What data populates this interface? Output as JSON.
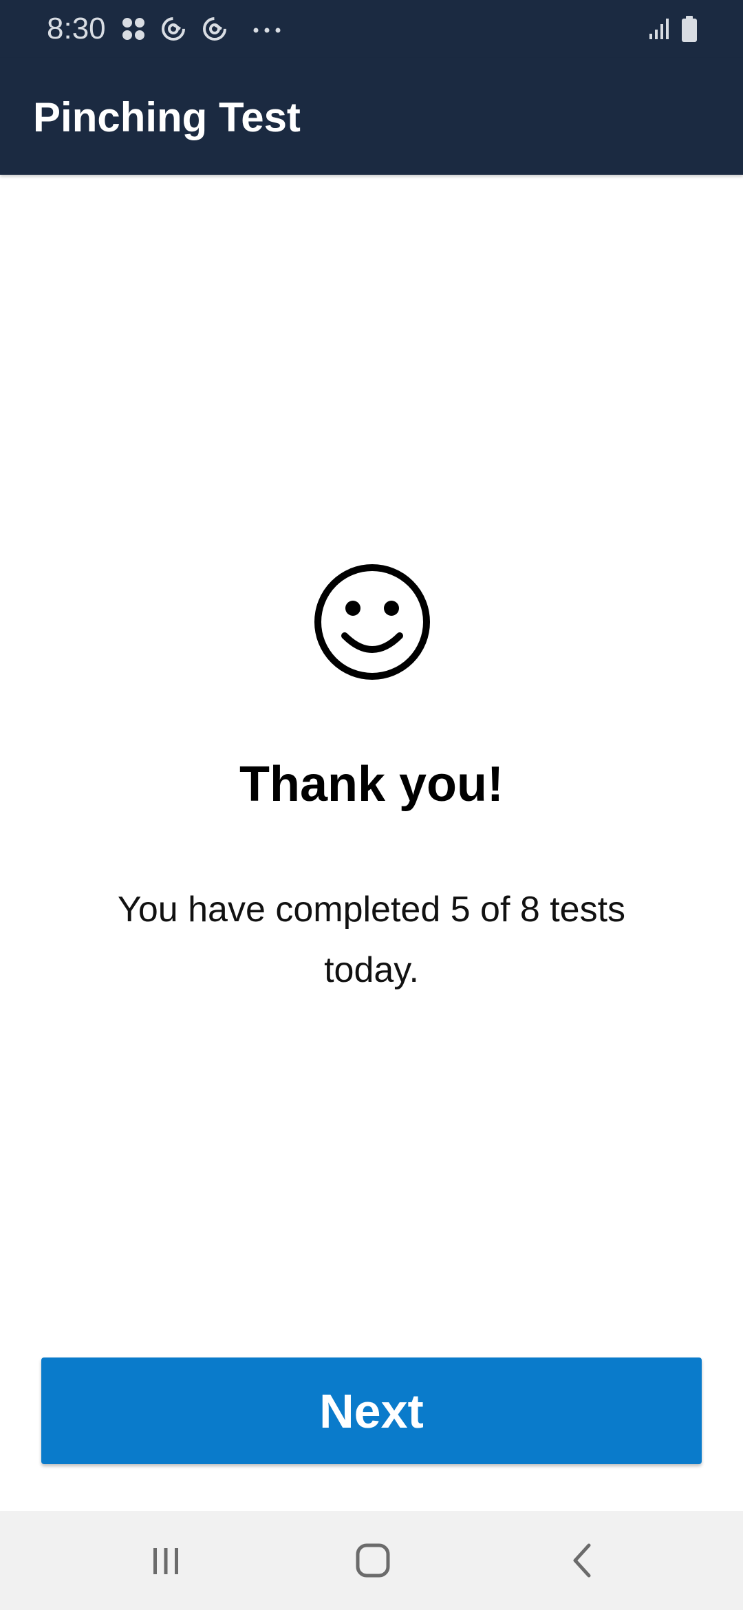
{
  "status_bar": {
    "time": "8:30",
    "left_icons": [
      "app-grid-icon",
      "sync-icon",
      "sync-icon",
      "more-dots-icon"
    ],
    "right_icons": [
      "signal-icon",
      "battery-icon"
    ]
  },
  "app_bar": {
    "title": "Pinching Test"
  },
  "content": {
    "icon": "smiley-face-icon",
    "heading": "Thank you!",
    "message": "You have completed 5 of 8 tests today.",
    "tests_completed": 5,
    "tests_total": 8
  },
  "actions": {
    "next_label": "Next"
  },
  "nav_bar": {
    "buttons": [
      "recent-apps-icon",
      "home-icon",
      "back-icon"
    ]
  },
  "colors": {
    "app_bar": "#1b2a41",
    "primary_button": "#0a7bcb",
    "nav_bar": "#f1f1f1"
  }
}
